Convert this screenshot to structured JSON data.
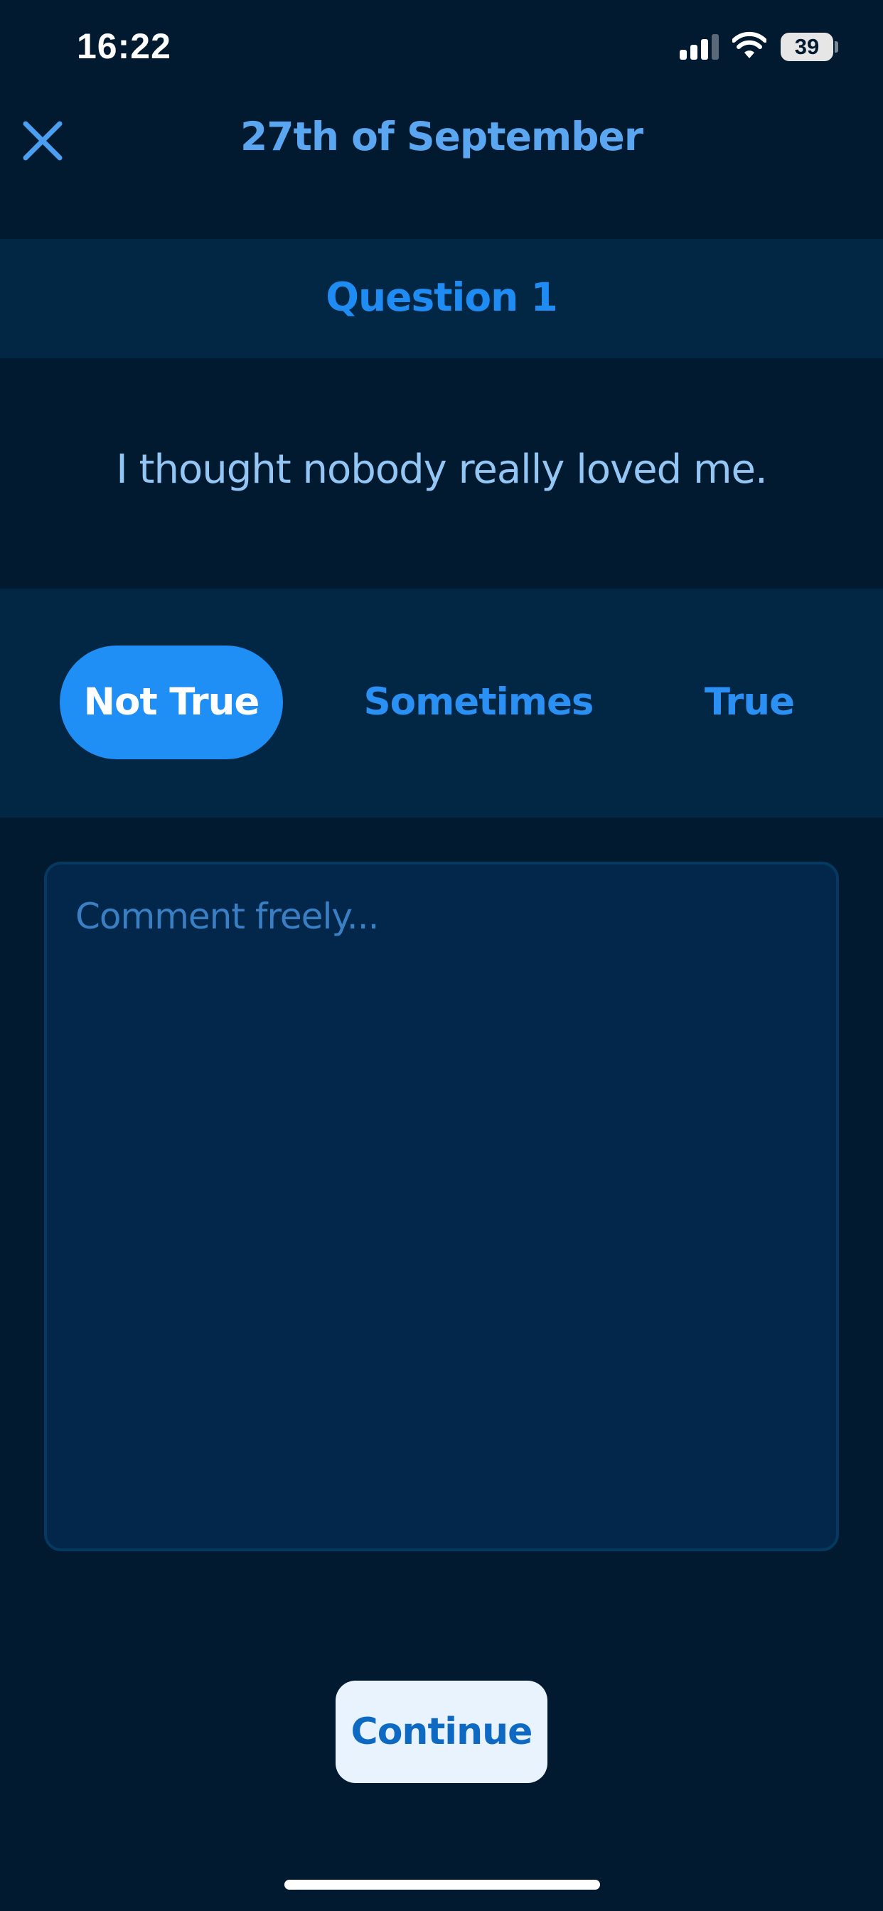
{
  "status_bar": {
    "time": "16:22",
    "battery_level": "39"
  },
  "header": {
    "title": "27th of September",
    "close_icon": "close-icon"
  },
  "question": {
    "label": "Question 1",
    "text": "I thought nobody really loved me."
  },
  "answers": {
    "options": [
      "Not True",
      "Sometimes",
      "True"
    ],
    "selected": "Not True"
  },
  "comment": {
    "placeholder": "Comment freely...",
    "value": ""
  },
  "continue_label": "Continue",
  "colors": {
    "background": "#011a2f",
    "band": "#022745",
    "accent": "#1f8ef5",
    "title": "#5aa6f0",
    "question_text": "#94c6f5",
    "button_bg": "#e9f3fd",
    "button_text": "#0d69c1"
  }
}
